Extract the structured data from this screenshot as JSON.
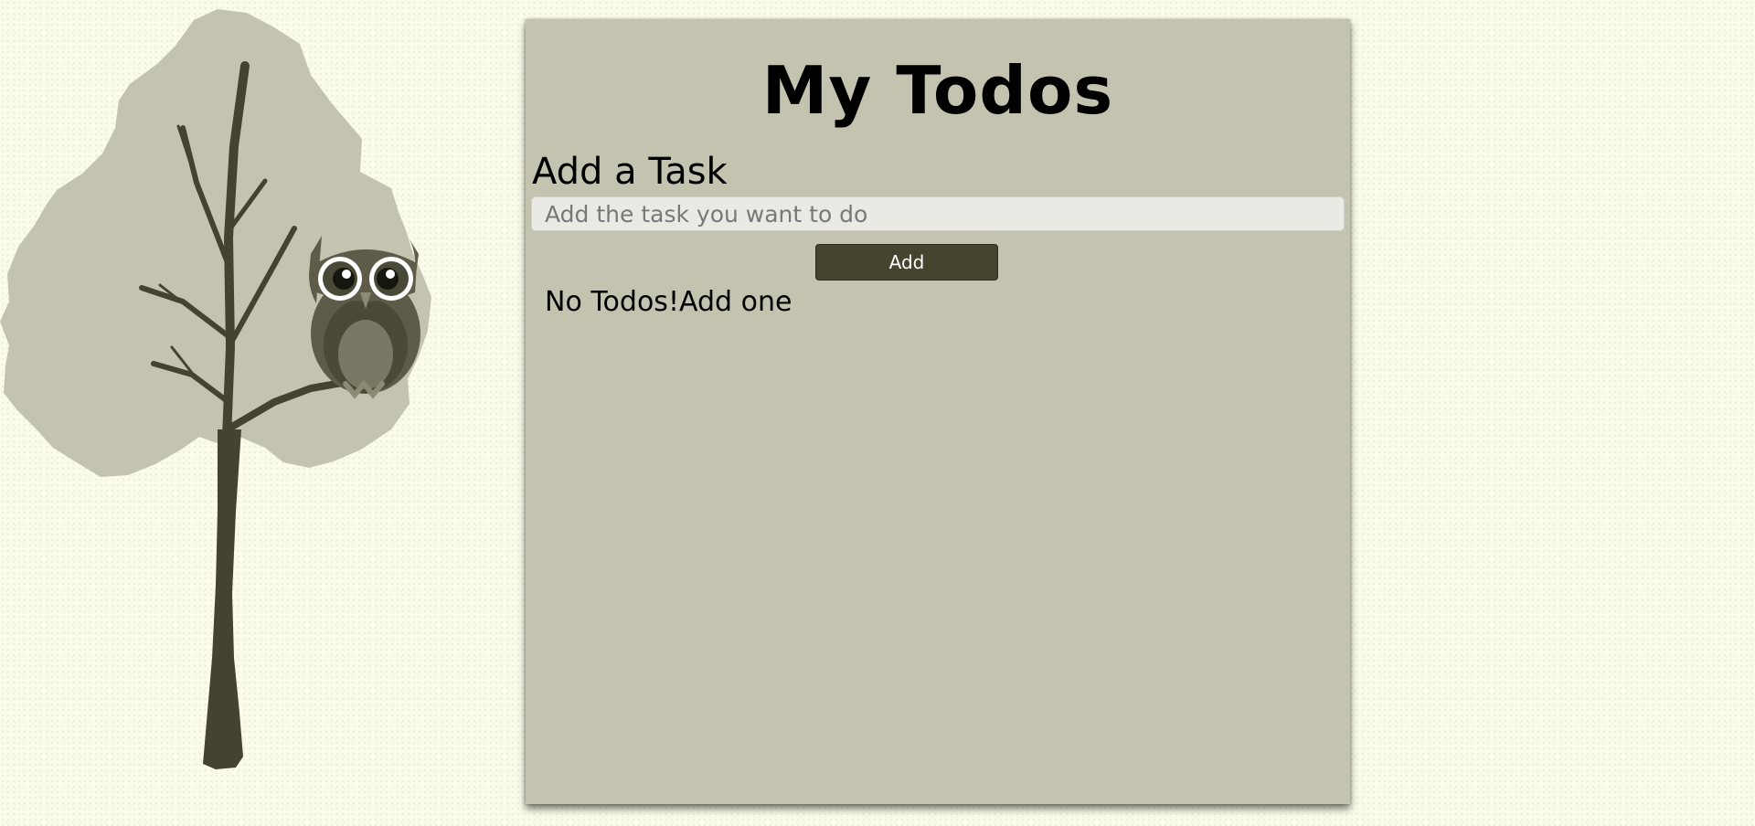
{
  "app": {
    "title": "My Todos"
  },
  "add_task": {
    "heading": "Add a Task",
    "input_value": "",
    "placeholder": "Add the task you want to do",
    "button_label": "Add"
  },
  "todos": {
    "items": [],
    "empty_message": "No Todos!Add one"
  },
  "illustration": {
    "icon": "tree-with-owl-illustration"
  },
  "colors": {
    "page_background": "#fbfbea",
    "panel_background": "#c4c3b0",
    "button_background": "#46442f",
    "button_text": "#ffffff",
    "input_background": "#ebe9e4",
    "foliage": "#c4c3b0",
    "trunk": "#45432f",
    "owl_body": "#5e5c48"
  }
}
